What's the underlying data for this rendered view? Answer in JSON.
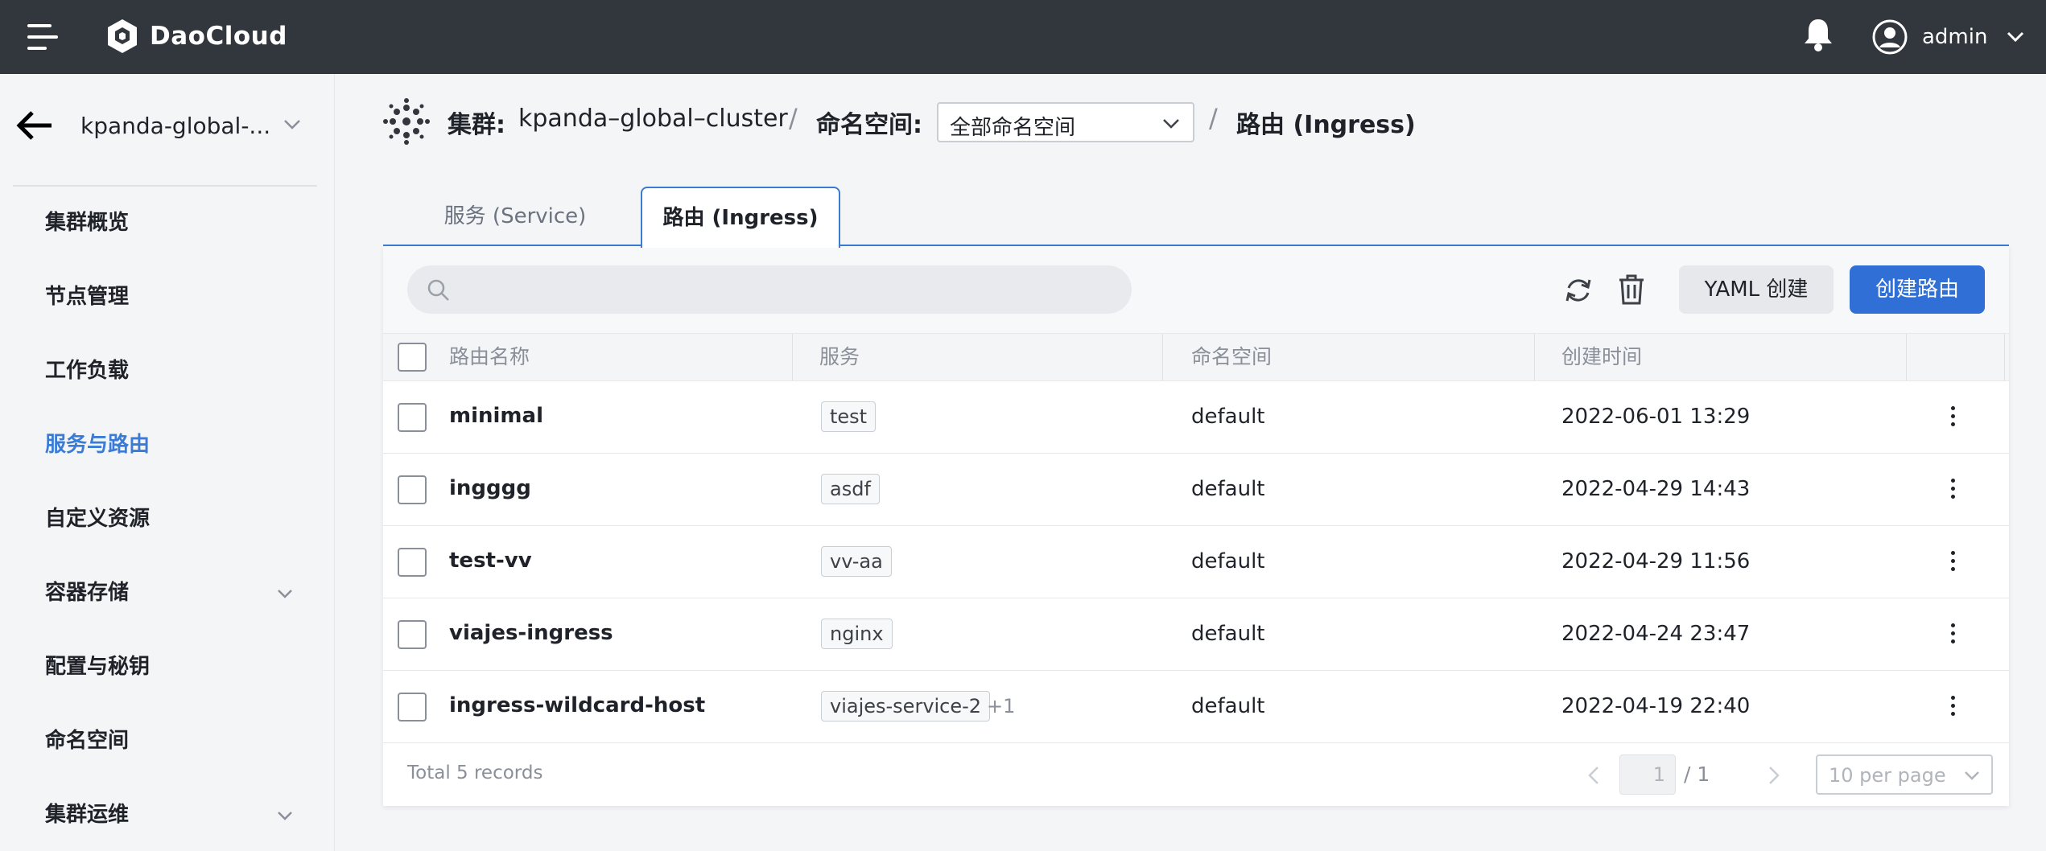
{
  "app": {
    "brand": "DaoCloud",
    "user": "admin"
  },
  "sidebar": {
    "cluster": "kpanda-global-...",
    "items": [
      {
        "label": "集群概览",
        "active": false,
        "expandable": false
      },
      {
        "label": "节点管理",
        "active": false,
        "expandable": false
      },
      {
        "label": "工作负载",
        "active": false,
        "expandable": false
      },
      {
        "label": "服务与路由",
        "active": true,
        "expandable": false
      },
      {
        "label": "自定义资源",
        "active": false,
        "expandable": false
      },
      {
        "label": "容器存储",
        "active": false,
        "expandable": true
      },
      {
        "label": "配置与秘钥",
        "active": false,
        "expandable": false
      },
      {
        "label": "命名空间",
        "active": false,
        "expandable": false
      },
      {
        "label": "集群运维",
        "active": false,
        "expandable": true
      }
    ]
  },
  "breadcrumb": {
    "cluster_label": "集群:",
    "cluster_value": "kpanda–global–cluster",
    "sep": "/",
    "namespace_label": "命名空间:",
    "namespace_value": "全部命名空间",
    "current": "路由 (Ingress)"
  },
  "tabs": [
    {
      "label": "服务 (Service)",
      "active": false
    },
    {
      "label": "路由 (Ingress)",
      "active": true
    }
  ],
  "toolbar": {
    "search_placeholder": "",
    "yaml_create": "YAML 创建",
    "create": "创建路由"
  },
  "table": {
    "columns": [
      "路由名称",
      "服务",
      "命名空间",
      "创建时间"
    ],
    "rows": [
      {
        "name": "minimal",
        "service": "test",
        "more": "",
        "namespace": "default",
        "created": "2022-06-01 13:29"
      },
      {
        "name": "ingggg",
        "service": "asdf",
        "more": "",
        "namespace": "default",
        "created": "2022-04-29 14:43"
      },
      {
        "name": "test-vv",
        "service": "vv-aa",
        "more": "",
        "namespace": "default",
        "created": "2022-04-29 11:56"
      },
      {
        "name": "viajes-ingress",
        "service": "nginx",
        "more": "",
        "namespace": "default",
        "created": "2022-04-24 23:47"
      },
      {
        "name": "ingress-wildcard-host",
        "service": "viajes-service-2",
        "more": "+1",
        "namespace": "default",
        "created": "2022-04-19 22:40"
      }
    ]
  },
  "pagination": {
    "total": "Total 5 records",
    "page": "1",
    "of": "/ 1",
    "page_size": "10 per page"
  },
  "colors": {
    "topbar": "#32363d",
    "primary": "#2f6fd6",
    "active_nav": "#3a7bd5"
  }
}
